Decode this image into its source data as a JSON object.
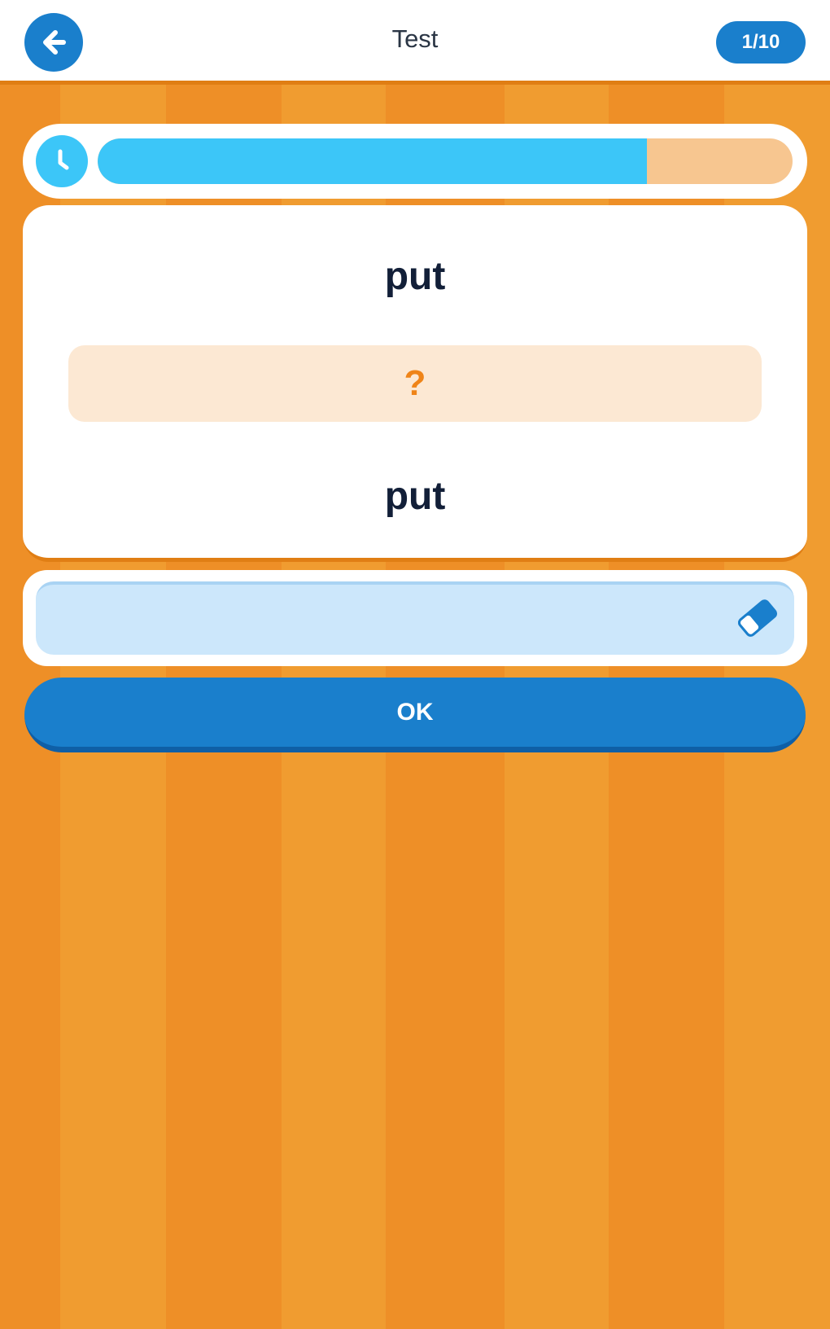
{
  "header": {
    "title": "Test",
    "counter": "1/10",
    "back_icon": "arrow-left-icon"
  },
  "timer": {
    "icon": "clock-icon",
    "remaining_fraction": 0.79,
    "fill_color": "#3cc6f8",
    "track_color": "#f7c690"
  },
  "question": {
    "word_top": "put",
    "answer_placeholder": "?",
    "word_bottom": "put"
  },
  "answer_input": {
    "value": "",
    "placeholder": "",
    "clear_icon": "eraser-icon"
  },
  "actions": {
    "ok_label": "OK"
  },
  "colors": {
    "accent_blue": "#1a7fcc",
    "background_orange": "#ee8f27",
    "question_mark_orange": "#ef8418"
  }
}
